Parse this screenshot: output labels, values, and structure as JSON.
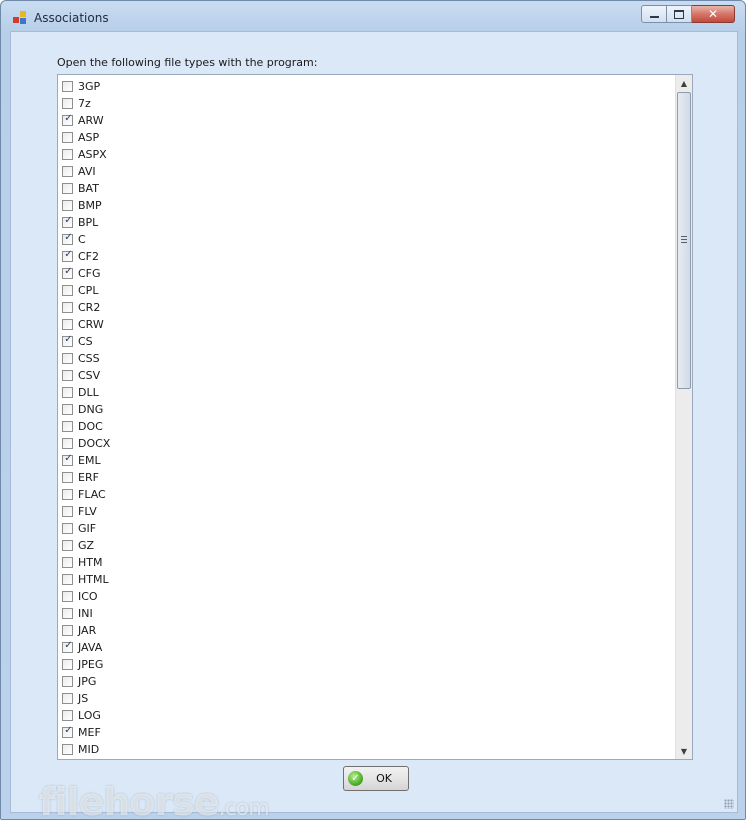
{
  "window": {
    "title": "Associations",
    "minimize_glyph": "",
    "maximize_glyph": "",
    "close_glyph": "✕"
  },
  "dialog": {
    "instruction": "Open the following file types with the program:",
    "ok_label": "OK"
  },
  "file_types": [
    {
      "name": "3GP",
      "checked": false
    },
    {
      "name": "7z",
      "checked": false
    },
    {
      "name": "ARW",
      "checked": true
    },
    {
      "name": "ASP",
      "checked": false
    },
    {
      "name": "ASPX",
      "checked": false
    },
    {
      "name": "AVI",
      "checked": false
    },
    {
      "name": "BAT",
      "checked": false
    },
    {
      "name": "BMP",
      "checked": false
    },
    {
      "name": "BPL",
      "checked": true
    },
    {
      "name": "C",
      "checked": true
    },
    {
      "name": "CF2",
      "checked": true
    },
    {
      "name": "CFG",
      "checked": true
    },
    {
      "name": "CPL",
      "checked": false
    },
    {
      "name": "CR2",
      "checked": false
    },
    {
      "name": "CRW",
      "checked": false
    },
    {
      "name": "CS",
      "checked": true
    },
    {
      "name": "CSS",
      "checked": false
    },
    {
      "name": "CSV",
      "checked": false
    },
    {
      "name": "DLL",
      "checked": false
    },
    {
      "name": "DNG",
      "checked": false
    },
    {
      "name": "DOC",
      "checked": false
    },
    {
      "name": "DOCX",
      "checked": false
    },
    {
      "name": "EML",
      "checked": true
    },
    {
      "name": "ERF",
      "checked": false
    },
    {
      "name": "FLAC",
      "checked": false
    },
    {
      "name": "FLV",
      "checked": false
    },
    {
      "name": "GIF",
      "checked": false
    },
    {
      "name": "GZ",
      "checked": false
    },
    {
      "name": "HTM",
      "checked": false
    },
    {
      "name": "HTML",
      "checked": false
    },
    {
      "name": "ICO",
      "checked": false
    },
    {
      "name": "INI",
      "checked": false
    },
    {
      "name": "JAR",
      "checked": false
    },
    {
      "name": "JAVA",
      "checked": true
    },
    {
      "name": "JPEG",
      "checked": false
    },
    {
      "name": "JPG",
      "checked": false
    },
    {
      "name": "JS",
      "checked": false
    },
    {
      "name": "LOG",
      "checked": false
    },
    {
      "name": "MEF",
      "checked": true
    },
    {
      "name": "MID",
      "checked": false
    }
  ],
  "watermark": {
    "brand": "filehorse",
    "suffix": ".com"
  },
  "colors": {
    "frame": "#bcd2ec",
    "client": "#dbe8f7",
    "close_button": "#c24a3c",
    "check": "#2b3f66"
  },
  "icons": {
    "app": "app-icon",
    "ok": "check-circle-icon",
    "grip": "scrollbar-grip-icon"
  }
}
